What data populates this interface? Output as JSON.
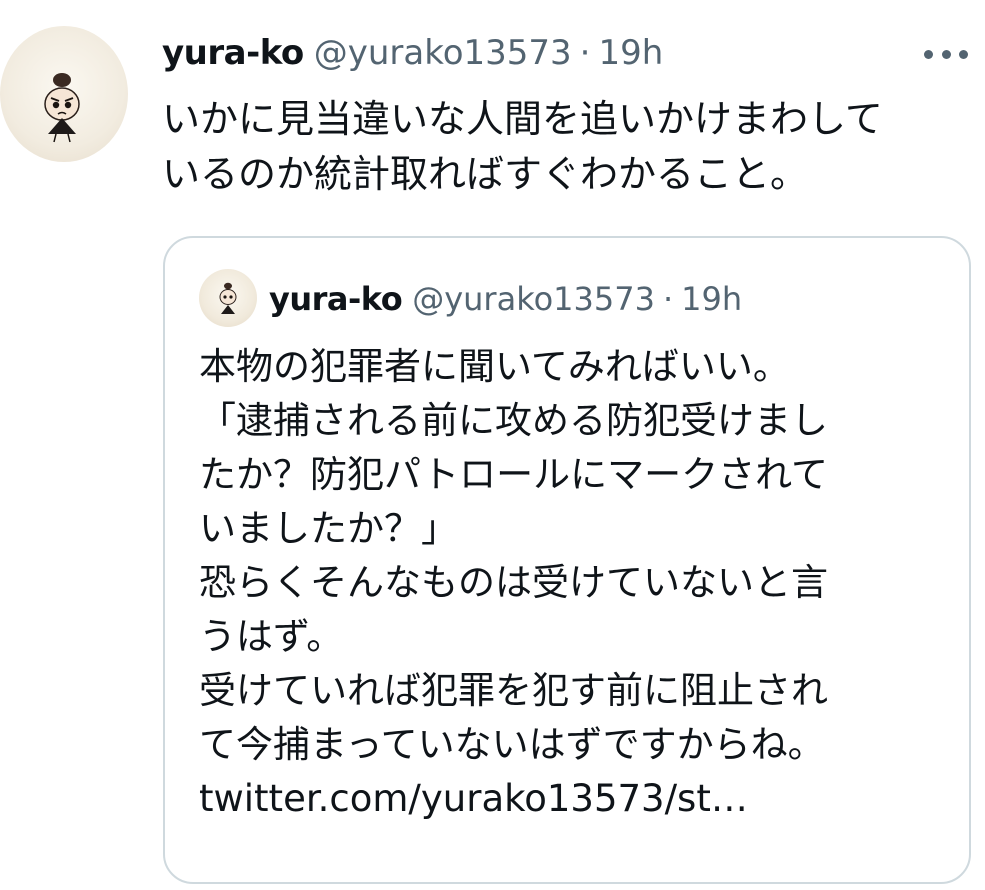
{
  "tweet": {
    "author_name": "yura-ko",
    "author_handle": "@yurako13573",
    "separator": "·",
    "time": "19h",
    "more_icon": "more-horizontal-icon",
    "text_lines": [
      "いかに見当違いな人間を追いかけまわして",
      "いるのか統計取ればすぐわかること。"
    ]
  },
  "quoted_tweet": {
    "author_name": "yura-ko",
    "author_handle": "@yurako13573",
    "separator": "·",
    "time": "19h",
    "text_lines": [
      "本物の犯罪者に聞いてみればいい。",
      "「逮捕される前に攻める防犯受けまし",
      "たか？防犯パトロールにマークされて",
      "いましたか？」",
      "恐らくそんなものは受けていないと言",
      "うはず。",
      "受けていれば犯罪を犯す前に阻止され",
      "て今捕まっていないはずですからね。"
    ],
    "link": "twitter.com/yurako13573/st…"
  },
  "colors": {
    "text": "#0f1419",
    "secondary": "#536471",
    "border": "#cfd9de"
  }
}
